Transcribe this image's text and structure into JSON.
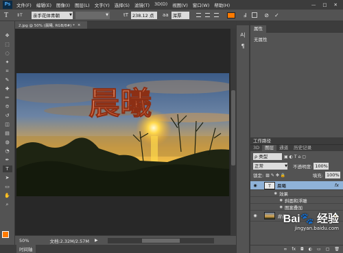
{
  "app": {
    "logo": "Ps"
  },
  "menu": [
    "文件(F)",
    "编辑(E)",
    "图像(I)",
    "图层(L)",
    "文字(Y)",
    "选择(S)",
    "滤镜(T)",
    "3D(D)",
    "视图(V)",
    "窗口(W)",
    "帮助(H)"
  ],
  "window_controls": {
    "minimize": "—",
    "maximize": "□",
    "close": "✕"
  },
  "options": {
    "tool_glyph": "T",
    "orient_glyph": "⇕T",
    "font": "亲手花体青朝",
    "style": "",
    "size": "238.12 点",
    "aa_glyph": "aa",
    "aa_mode": "浑厚",
    "color": "#ff7a00"
  },
  "doc_tab": {
    "title": "2.jpg @ 50% (晨曦, RGB/8#) *",
    "close": "×"
  },
  "artwork": {
    "big_text": "晨曦",
    "accent_color": "#f47a3a"
  },
  "status": {
    "zoom": "50%",
    "doc": "文档:2.32M/2.57M",
    "tab": "时间轴"
  },
  "properties": {
    "tab": "属性",
    "title": "无属性"
  },
  "layers_panel": {
    "header": "工作路径",
    "tabs": [
      "3D",
      "图层",
      "通道",
      "历史记录"
    ],
    "filter": "ρ 类型",
    "blend": "正常",
    "opacity_label": "不透明度:",
    "opacity": "100%",
    "lock_label": "锁定:",
    "fill_label": "填充:",
    "fill": "100%",
    "layers": [
      {
        "thumb": "T",
        "name": "晨曦",
        "fx": "fx",
        "selected": true
      },
      {
        "name": "效果",
        "indent": 1
      },
      {
        "name": "斜面和浮雕",
        "indent": 2
      },
      {
        "name": "图案叠加",
        "indent": 2
      },
      {
        "name": "背景",
        "bg": true
      }
    ]
  },
  "watermark": {
    "main": "Bai🐾 经验",
    "sub": "jingyan.baidu.com"
  }
}
